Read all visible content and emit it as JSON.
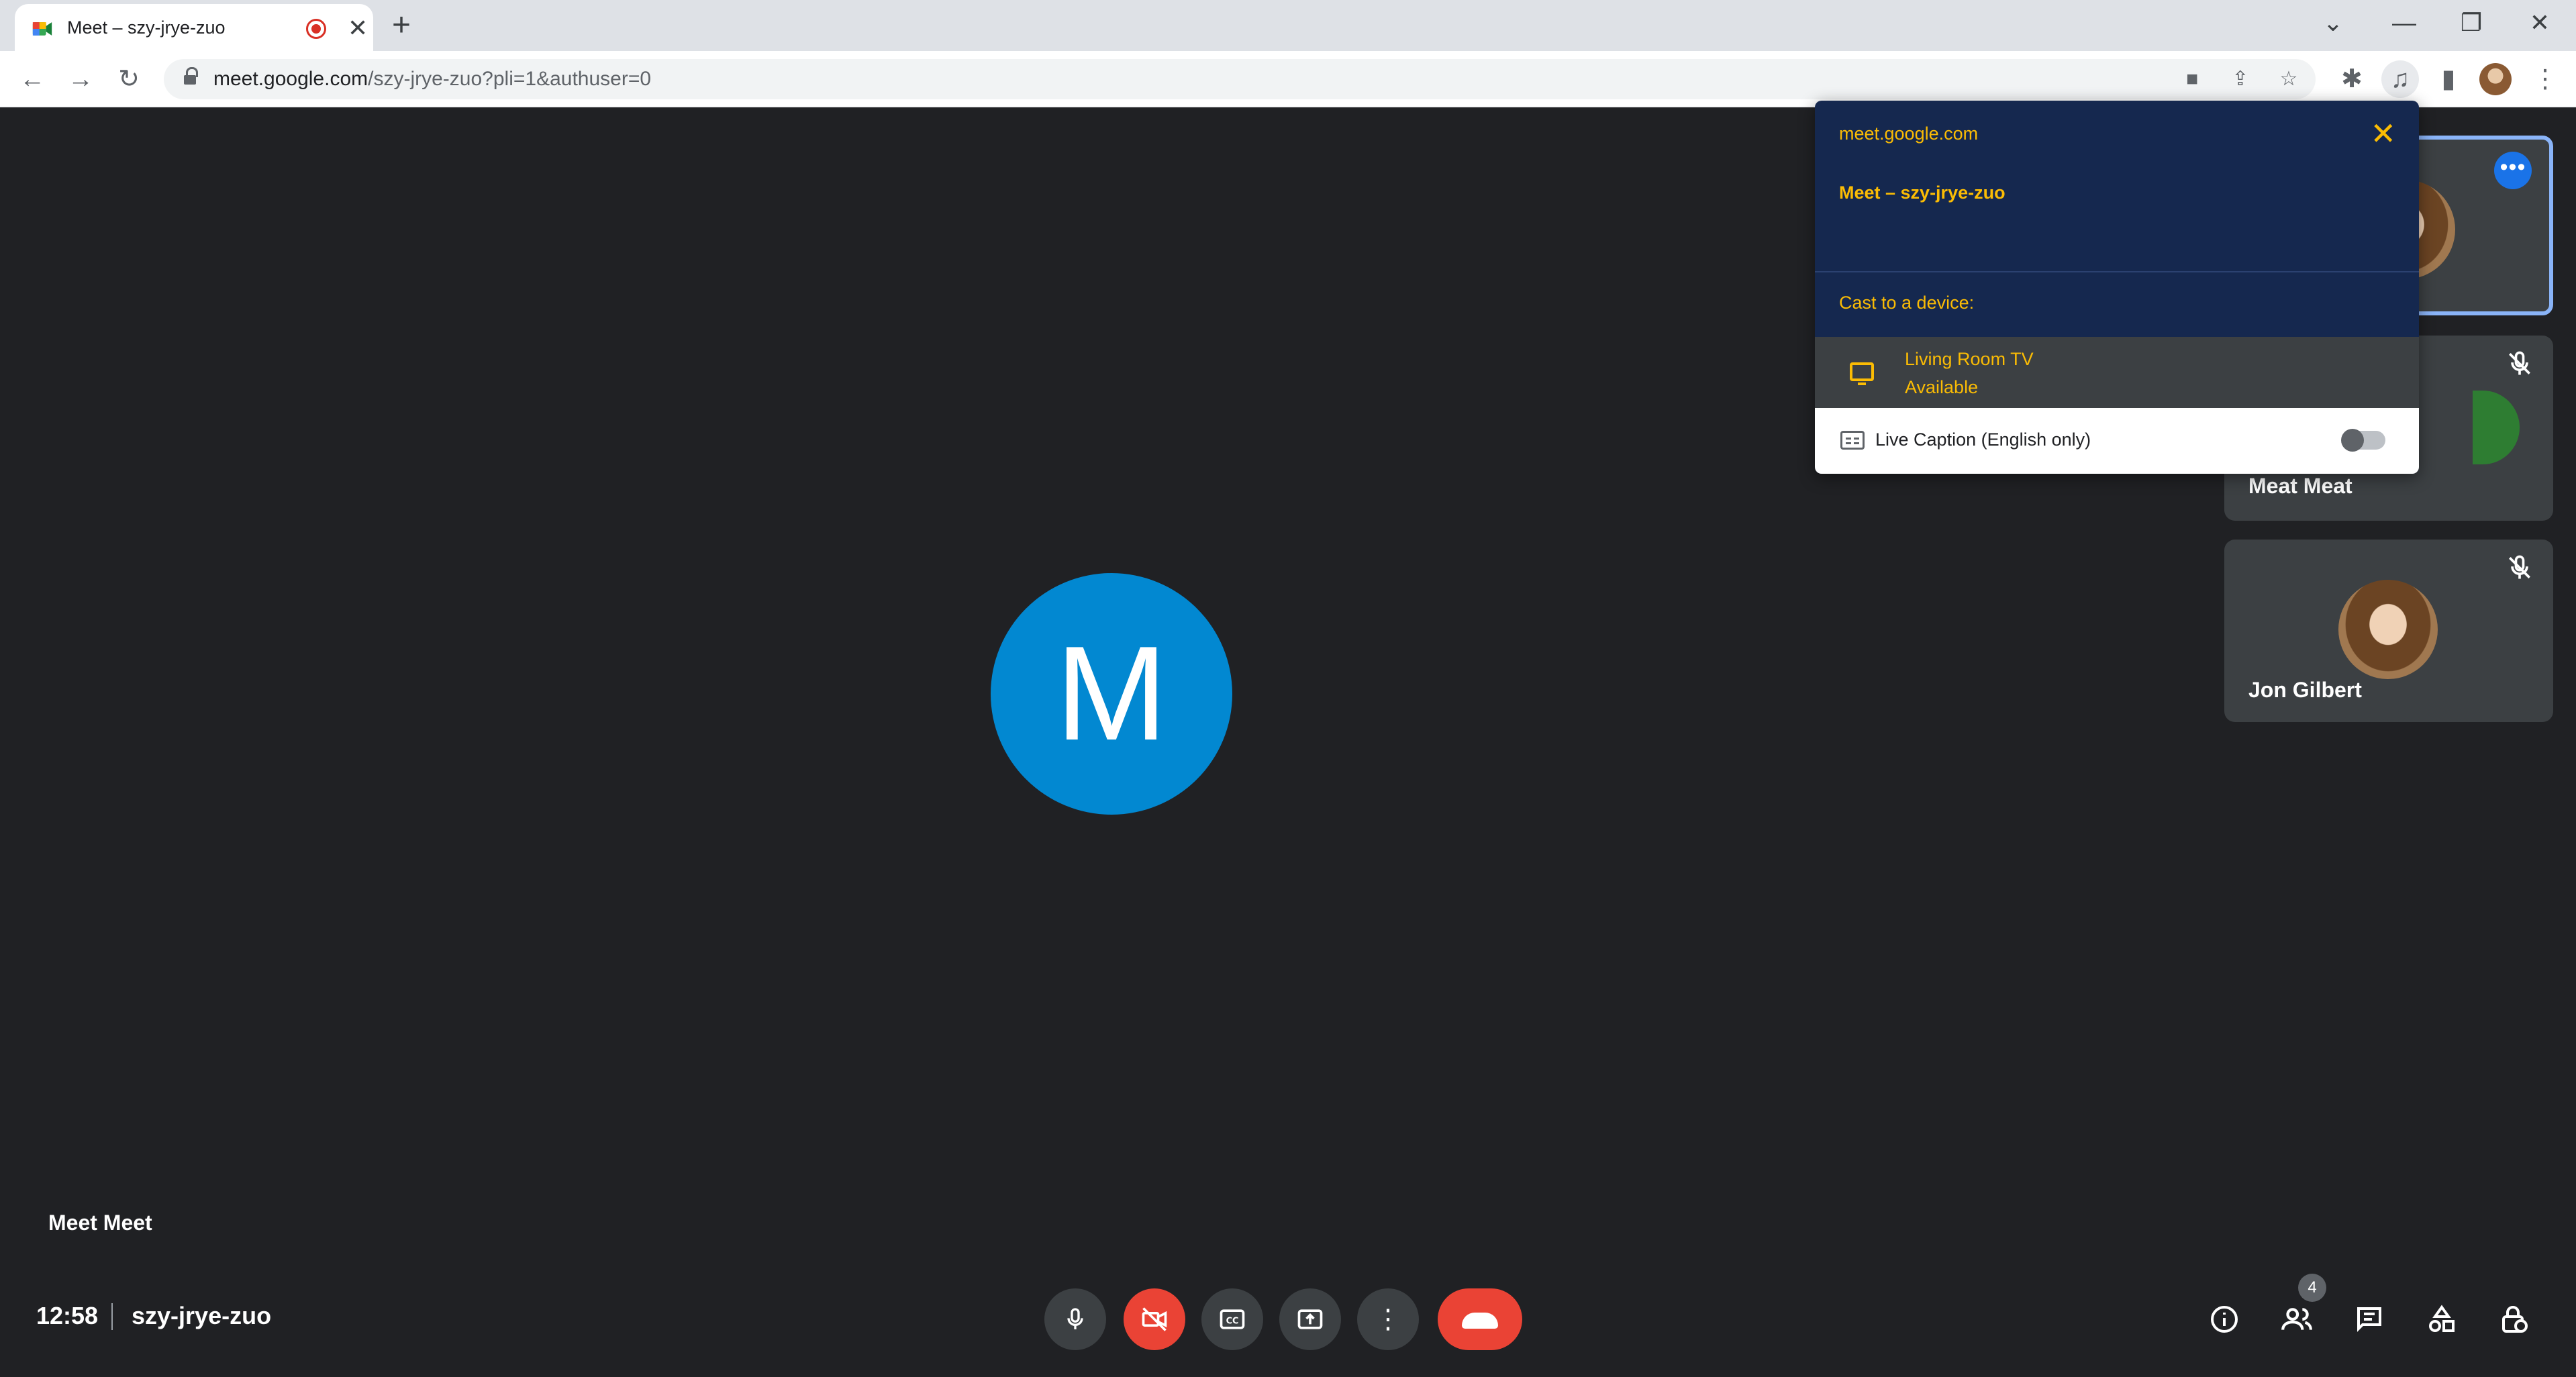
{
  "browser": {
    "tab_title": "Meet – szy-jrye-zuo",
    "tab_close": "✕",
    "new_tab": "+",
    "url_host": "meet.google.com",
    "url_path": "/szy-jrye-zuo?pli=1&authuser=0"
  },
  "cast_dialog": {
    "origin": "meet.google.com",
    "close": "✕",
    "source": "Meet – szy-jrye-zuo",
    "heading": "Cast to a device:",
    "device_name": "Living Room TV",
    "device_status": "Available",
    "caption_label": "Live Caption (English only)",
    "caption_enabled": false
  },
  "meeting": {
    "main_initial": "M",
    "main_name": "Meet Meet",
    "time": "12:58",
    "code": "szy-jrye-zuo",
    "participant_count": "4",
    "avatar_color": "#0288d1"
  },
  "tiles": [
    {
      "name": ""
    },
    {
      "name": "Meat Meat"
    },
    {
      "name": "Jon Gilbert"
    }
  ],
  "colors": {
    "background": "#202124",
    "accent": "#fbbc04",
    "danger": "#ea4335",
    "highlight": "#8ab4f8"
  }
}
